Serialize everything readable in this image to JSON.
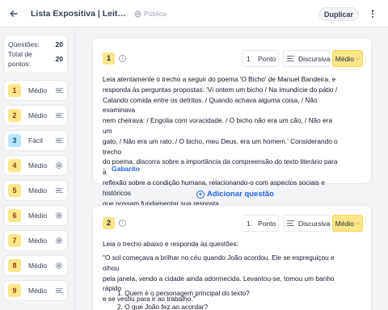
{
  "header": {
    "back_icon": "arrow-left-icon",
    "title": "Lista Expositiva | Leitura e ...",
    "visibility": "Pública",
    "duplicate_label": "Duplicar"
  },
  "stats": {
    "questions_label": "Questões:",
    "questions_value": "20",
    "points_label_1": "Total de",
    "points_label_2": "pontos:",
    "points_value": "20"
  },
  "sidebar": {
    "items": [
      {
        "num": "1",
        "difficulty": "Médio",
        "type": "discursive"
      },
      {
        "num": "2",
        "difficulty": "Médio",
        "type": "discursive"
      },
      {
        "num": "3",
        "difficulty": "Fácil",
        "type": "discursive"
      },
      {
        "num": "4",
        "difficulty": "Médio",
        "type": "objective"
      },
      {
        "num": "5",
        "difficulty": "Médio",
        "type": "discursive"
      },
      {
        "num": "6",
        "difficulty": "Médio",
        "type": "objective"
      },
      {
        "num": "7",
        "difficulty": "Médio",
        "type": "objective"
      },
      {
        "num": "8",
        "difficulty": "Médio",
        "type": "objective"
      },
      {
        "num": "9",
        "difficulty": "Médio",
        "type": "discursive"
      }
    ]
  },
  "questions": [
    {
      "num": "1",
      "points": "1",
      "points_label": "Ponto",
      "type_label": "Discursiva",
      "difficulty": "Médio",
      "lines": [
        "Leia atentamente o trecho a seguir do poema 'O Bicho' de Manuel Bandeira, e",
        "responda às perguntas propostas: 'Vi ontem um bicho / Na imundície do pátio /",
        "Catando comida entre os detritos. / Quando achava alguma coisa, / Não examinava",
        "nem cheirava: / Engolia com voracidade. / O bicho não era um cão, / Não era um",
        "gato, / Não era um rato. / O bicho, meu Deus, era um homem.' Considerando o trecho",
        "do poema, discorra sobre a importância da compreensão do texto literário para a",
        "reflexão sobre a condição humana, relacionando-o com aspectos sociais e históricos",
        "que possam fundamentar sua resposta."
      ],
      "answer_label": "Gabarito"
    },
    {
      "num": "2",
      "points": "1",
      "points_label": "Ponto",
      "type_label": "Discursiva",
      "difficulty": "Médio",
      "intro": "Leia o trecho abaixo e responda às questões:",
      "lines": [
        "\"O sol começava a brilhar no céu quando João acordou. Ele se espreguiçou e olhou",
        "pela janela, vendo a cidade ainda adormecida. Levantou-se, tomou um banho rápido",
        "e se vestiu para ir ao trabalho.\""
      ],
      "items": [
        "1. Quem é o personagem principal do texto?",
        "2. O que João fez ao acordar?"
      ]
    }
  ],
  "add_question_label": "Adicionar questão",
  "colors": {
    "accent": "#2563eb",
    "medium": "#fde68a",
    "easy": "#bae6fd"
  }
}
